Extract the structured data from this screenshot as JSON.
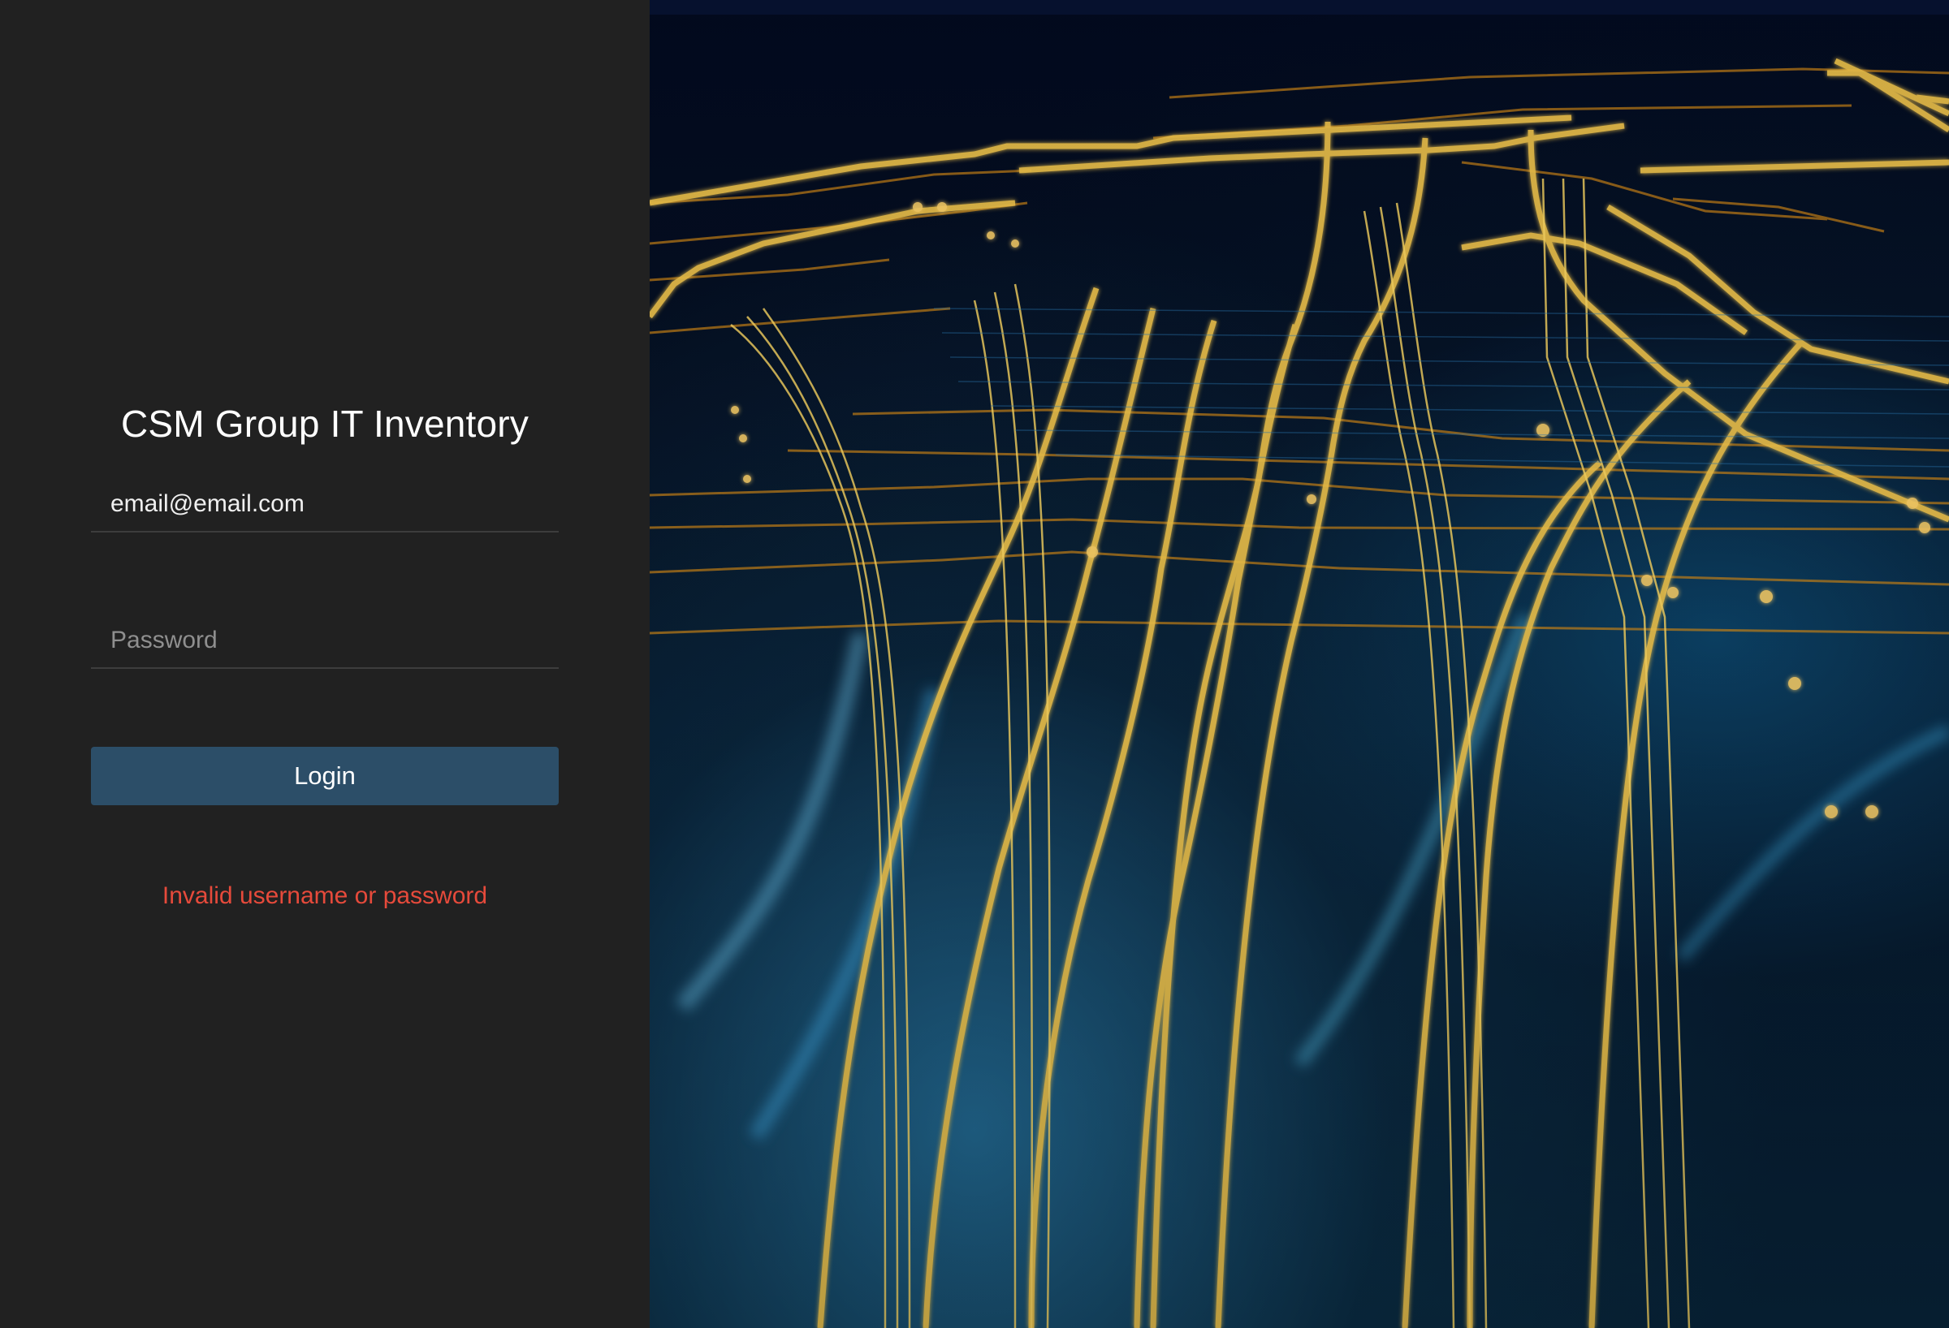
{
  "login": {
    "title": "CSM Group IT Inventory",
    "email_value": "email@email.com",
    "password_placeholder": "Password",
    "login_button": "Login",
    "error_message": "Invalid username or password"
  },
  "theme": {
    "panel_background": "#212121",
    "button_background": "#2c4e68",
    "error_color": "#e64a3b",
    "circuit_gold": "#f3c94d",
    "circuit_orange": "#d88712",
    "background_navy": "#03112a"
  },
  "background_image": {
    "subject": "circuit-board"
  }
}
